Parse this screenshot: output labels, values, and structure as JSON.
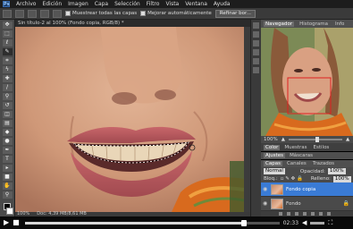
{
  "menu": [
    "Archivo",
    "Edición",
    "Imagen",
    "Capa",
    "Selección",
    "Filtro",
    "Vista",
    "Ventana",
    "Ayuda"
  ],
  "app_icon": "Ps",
  "options": {
    "sample_all_layers": "Muestrear todas las capas",
    "auto_enhance": "Mejorar automáticamente",
    "refine_edge": "Refinar bor..."
  },
  "document": {
    "tab_title": "Sin título-2 al 100% (Fondo copia, RGB/8) *",
    "zoom": "100%",
    "doc_info": "Doc: 4,39 MB/8,61 MB"
  },
  "panels": {
    "navigator_tab": "Navegador",
    "histogram_tab": "Histograma",
    "info_tab": "Info",
    "nav_zoom": "100%",
    "mid_tabs": [
      "Color",
      "Muestras",
      "Estilos"
    ],
    "adj_tabs": [
      "Ajustes",
      "Máscaras"
    ],
    "layer_tabs": [
      "Capas",
      "Canales",
      "Trazados"
    ],
    "blend_mode": "Normal",
    "opacity_label": "Opacidad:",
    "opacity_value": "100%",
    "lock_label": "Bloq.:",
    "fill_label": "Relleno:",
    "fill_value": "100%",
    "layers": [
      {
        "name": "Fondo copia",
        "selected": true
      },
      {
        "name": "Fondo",
        "selected": false
      }
    ]
  },
  "player": {
    "time": "02:33",
    "progress": 0.86
  },
  "colors": {
    "selection_blue": "#3a7bd5",
    "panel_bg": "#4a4a4a"
  },
  "icons": {
    "play": "play-icon",
    "stop": "stop-icon",
    "volume": "volume-icon",
    "fullscreen": "fullscreen-icon",
    "eye": "eye-icon",
    "lock": "lock-icon"
  }
}
